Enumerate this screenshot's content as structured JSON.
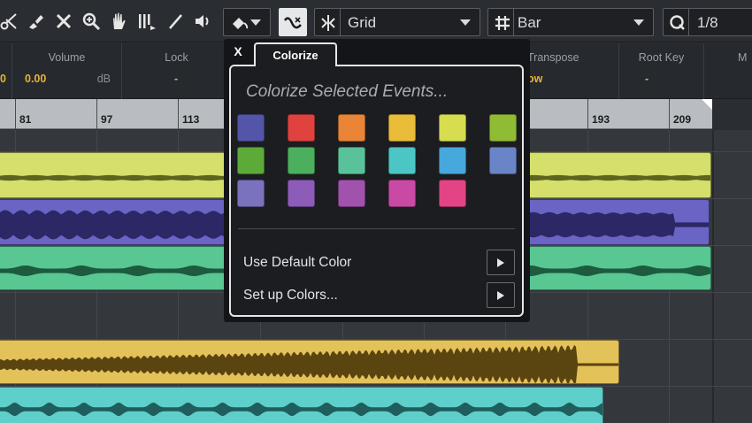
{
  "toolbar": {
    "snap_type": "Grid",
    "quantize_mode": "Bar",
    "quantize_value": "1/8",
    "icons": [
      "split-icon",
      "glue-icon",
      "erase-icon",
      "zoom-icon",
      "mute-icon",
      "time-warp-icon",
      "draw-icon",
      "speaker-icon",
      "color-bucket-icon",
      "snap-icon",
      "snap-mode-icon",
      "grid-hash-icon",
      "quantize-q-icon"
    ]
  },
  "infoline": {
    "columns": [
      {
        "header": "",
        "value": "0",
        "unit": ""
      },
      {
        "header": "Volume",
        "value": "0.00",
        "unit": "dB"
      },
      {
        "header": "Lock",
        "value": "-",
        "unit": ""
      },
      {
        "header": "Transpose",
        "value": "ow",
        "unit": ""
      },
      {
        "header": "Root Key",
        "value": "-",
        "unit": ""
      },
      {
        "header": "M",
        "value": "",
        "unit": ""
      }
    ]
  },
  "ruler": {
    "labels": [
      "81",
      "97",
      "113",
      "193",
      "209"
    ]
  },
  "colorize": {
    "tab_label": "Colorize",
    "close_label": "X",
    "title": "Colorize Selected Events...",
    "swatches": [
      "#5356a8",
      "#e0423f",
      "#ea8436",
      "#e9bd3a",
      "#d6dd4e",
      "#8fbb35",
      "#5cab38",
      "#4caf5e",
      "#5ac29a",
      "#4cc6c4",
      "#46a8dc",
      "#6a84c8",
      "#7a72bd",
      "#8d5cb8",
      "#a052ad",
      "#c84aa4",
      "#e24486"
    ],
    "menu_items": [
      {
        "label": "Use Default Color"
      },
      {
        "label": "Set up Colors..."
      }
    ]
  },
  "events": [
    {
      "color": "#d4df6c",
      "wave": "#5c6420"
    },
    {
      "color": "#6a64c4",
      "wave": "#2c2866"
    },
    {
      "color": "#58c792",
      "wave": "#1d5a3e"
    },
    {
      "color": "#e4c25a",
      "wave": "#5a4410"
    },
    {
      "color": "#5fcfcb",
      "wave": "#1f5e5c"
    }
  ]
}
